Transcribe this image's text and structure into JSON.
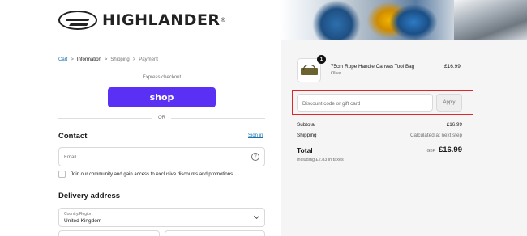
{
  "brand": {
    "name": "HIGHLANDER",
    "reg_mark": "®"
  },
  "breadcrumb": {
    "items": [
      "Cart",
      "Information",
      "Shipping",
      "Payment"
    ],
    "separator": ">"
  },
  "express_checkout": {
    "label": "Express checkout",
    "shop_button": "shop",
    "or_text": "OR"
  },
  "contact": {
    "heading": "Contact",
    "sign_in": "Sign in",
    "email_placeholder": "Email",
    "help_icon": "?",
    "newsletter_label": "Join our community and gain access to exclusive discounts and promotions."
  },
  "delivery": {
    "heading": "Delivery address",
    "country_label": "Country/Region",
    "country_value": "United Kingdom"
  },
  "order": {
    "item": {
      "name": "75cm Rope Handle Canvas Tool Bag",
      "variant": "Olive",
      "price": "£16.99",
      "quantity": "1"
    },
    "discount": {
      "placeholder": "Discount code or gift card",
      "apply_label": "Apply"
    },
    "subtotal": {
      "label": "Subtotal",
      "value": "£16.99"
    },
    "shipping": {
      "label": "Shipping",
      "value": "Calculated at next step"
    },
    "total": {
      "label": "Total",
      "currency": "GBP",
      "value": "£16.99",
      "taxes_note": "Including £2.83 in taxes"
    }
  },
  "colors": {
    "shop_pay_purple": "#5a31f4",
    "link_blue": "#1773b0",
    "highlight_red": "#e0262a"
  }
}
